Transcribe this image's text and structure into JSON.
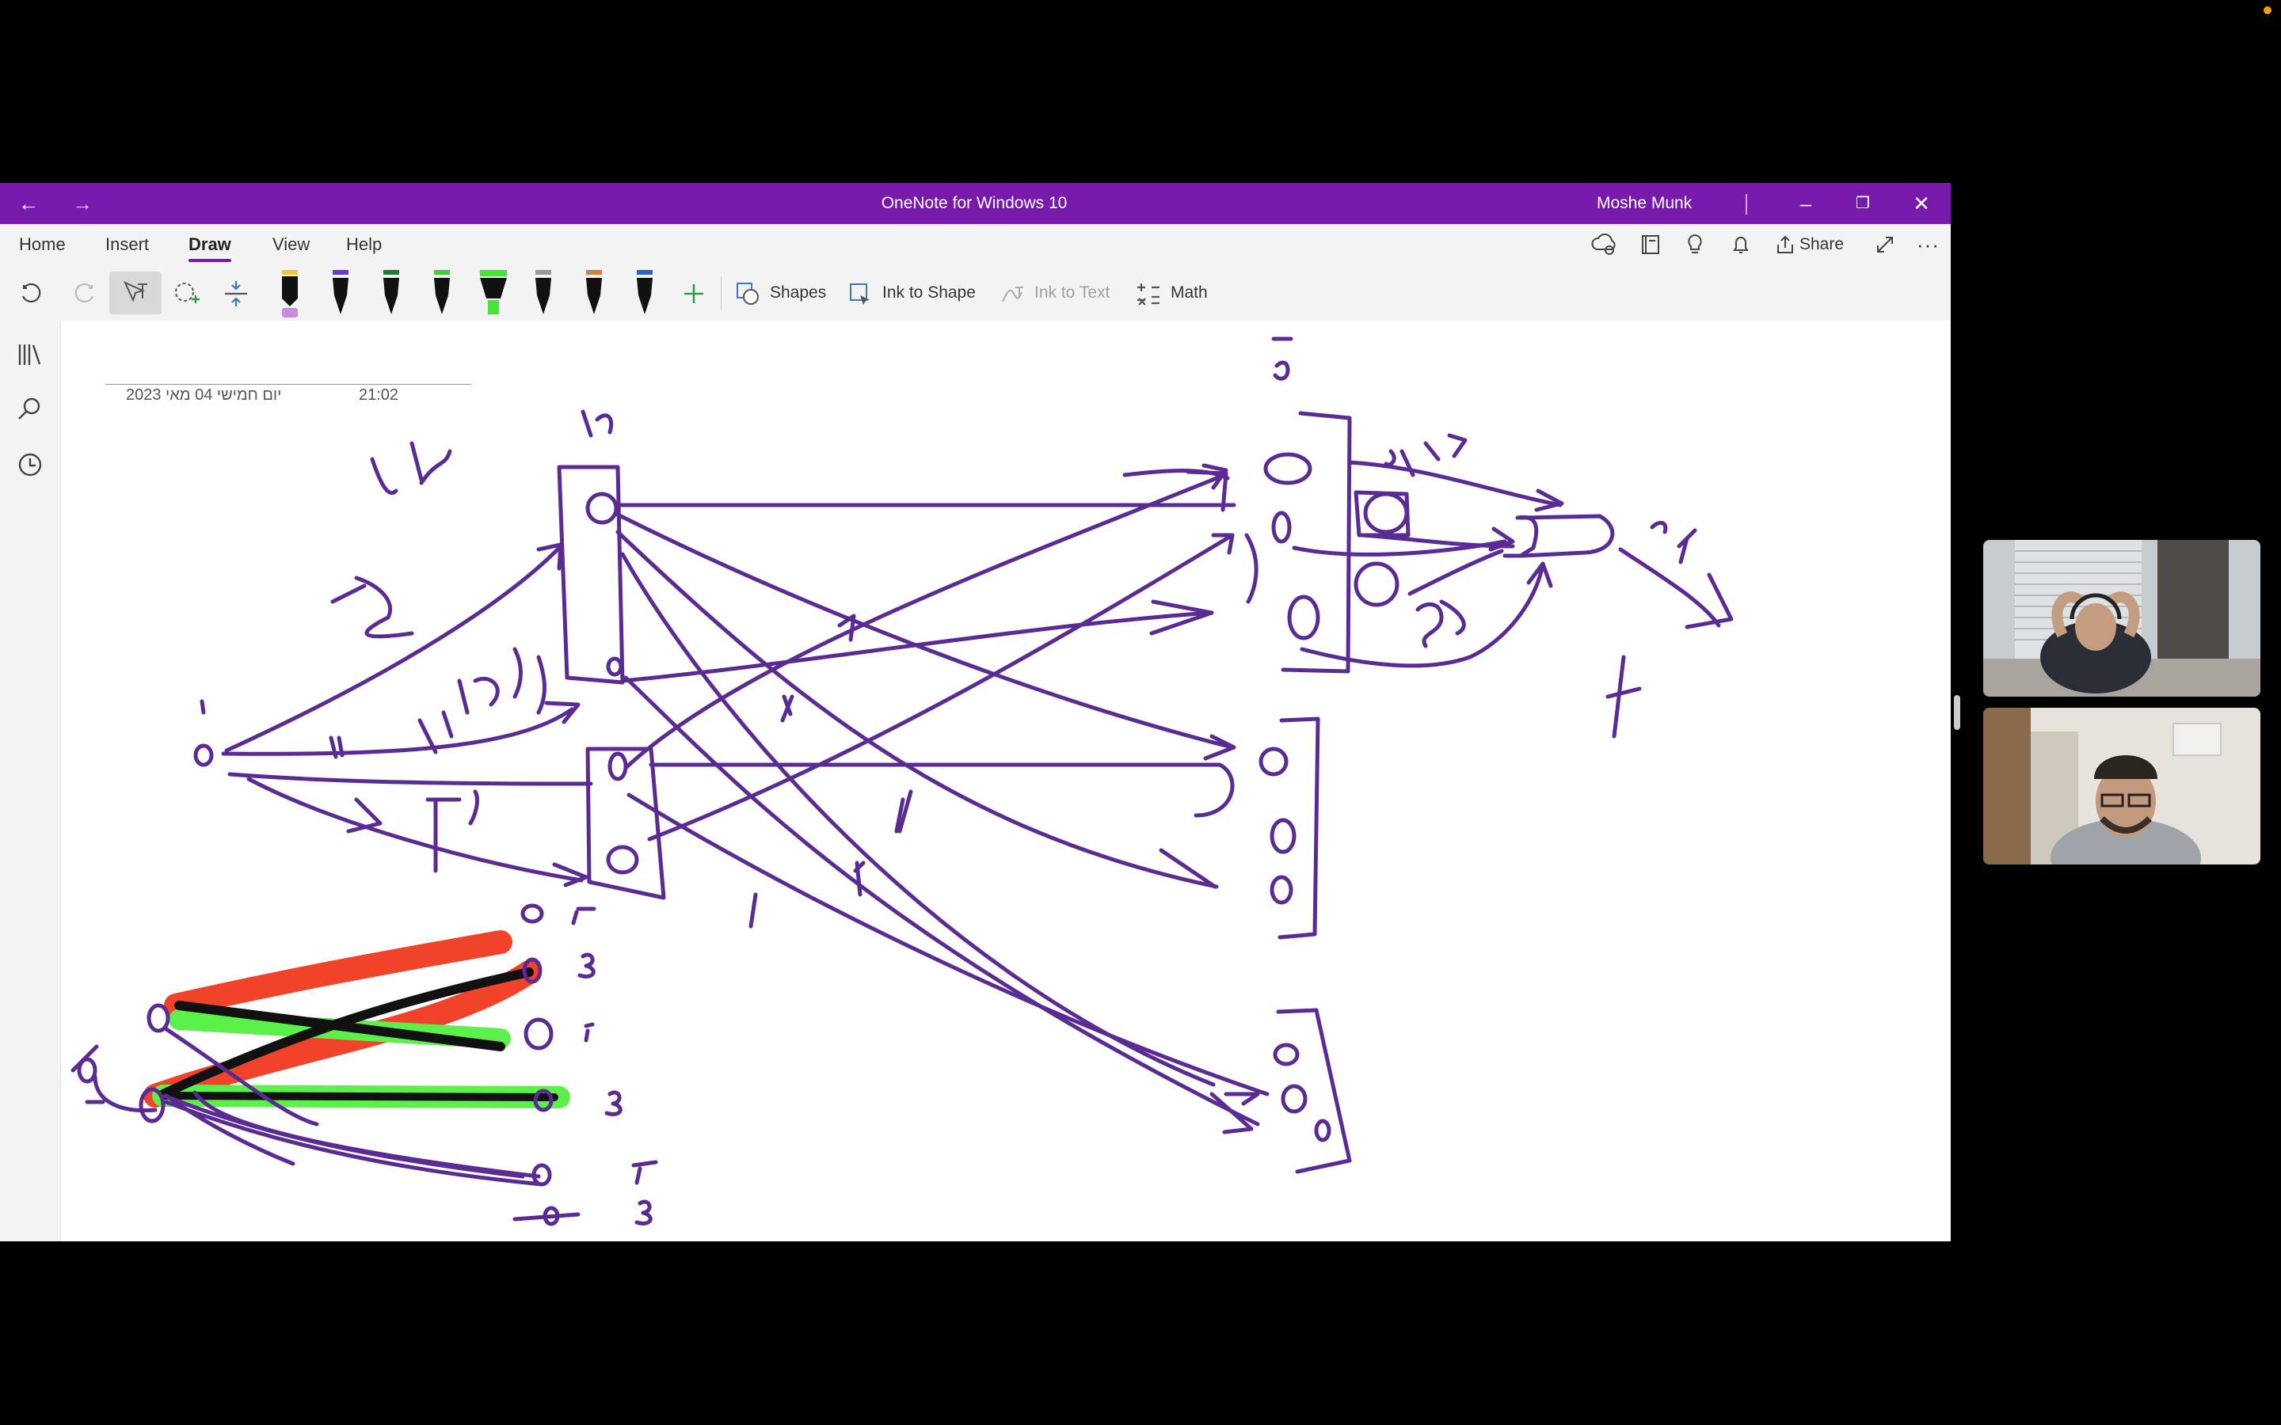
{
  "window": {
    "title": "OneNote for Windows 10",
    "user": "Moshe Munk"
  },
  "ribbon": {
    "tabs": [
      {
        "label": "Home"
      },
      {
        "label": "Insert"
      },
      {
        "label": "Draw",
        "active": true
      },
      {
        "label": "View"
      },
      {
        "label": "Help"
      }
    ],
    "share_label": "Share"
  },
  "toolbar": {
    "shapes_label": "Shapes",
    "ink_to_shape_label": "Ink to Shape",
    "ink_to_text_label": "Ink to Text",
    "math_label": "Math"
  },
  "page": {
    "date": "יום חמישי 04 מאי 2023",
    "time": "21:02"
  },
  "colors": {
    "brand": "#7719aa",
    "ink": "#5b2b94",
    "highlight_red": "#f0391f",
    "highlight_green": "#5cf04a"
  }
}
